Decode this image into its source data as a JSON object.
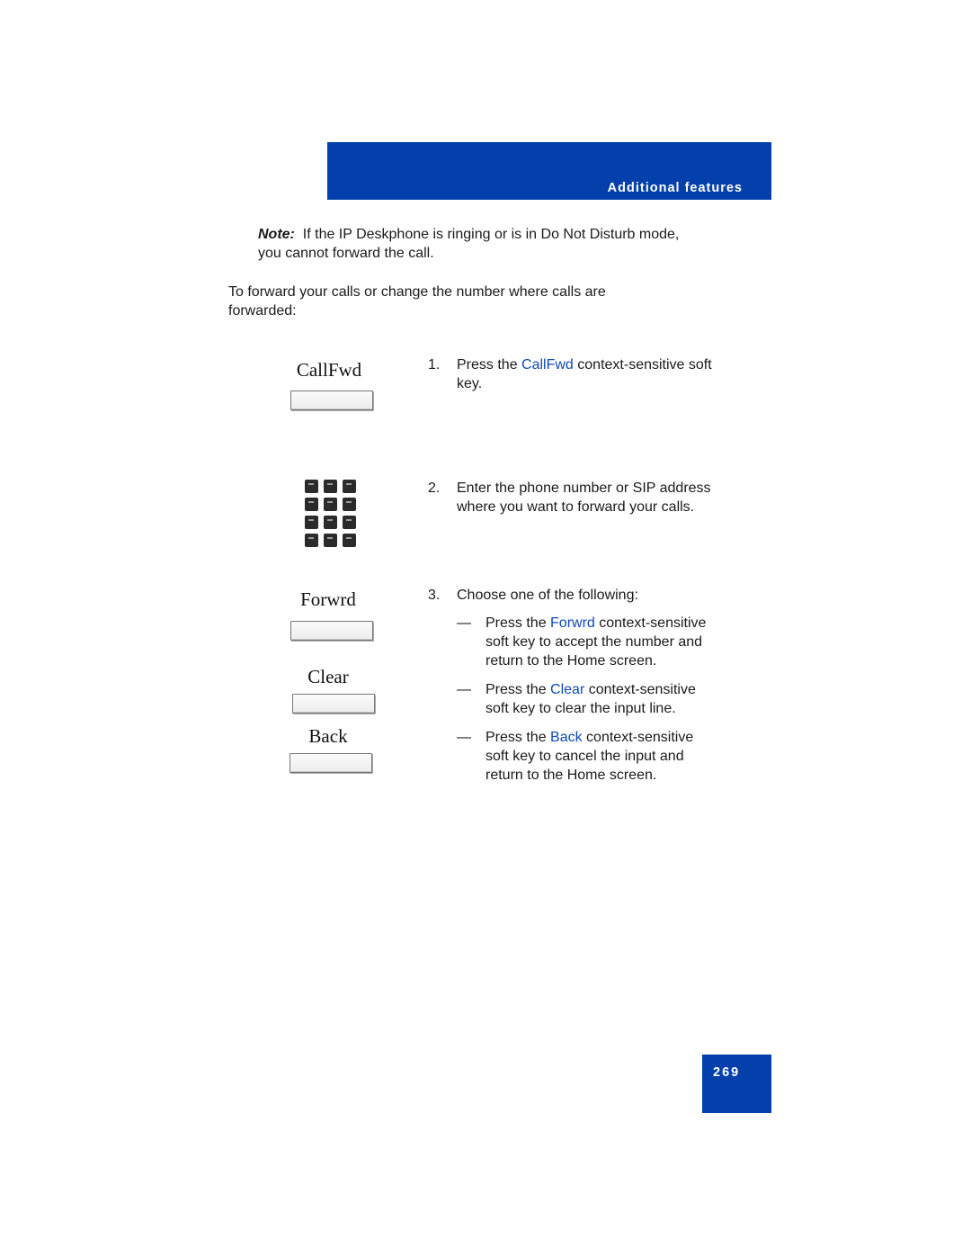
{
  "header": {
    "section_title": "Additional features",
    "color": "#0340AC"
  },
  "note": {
    "label": "Note:",
    "text_line1": "If the IP Deskphone is ringing or is in Do Not Disturb mode,",
    "text_line2": "you cannot forward the call."
  },
  "intro": {
    "line1": "To forward your calls or change the number where calls are",
    "line2": "forwarded:"
  },
  "softkeys": {
    "callfwd": "CallFwd",
    "forwrd": "Forwrd",
    "clear": "Clear",
    "back": "Back"
  },
  "keypad_icon": "dialpad-icon",
  "steps": [
    {
      "num": "1.",
      "pre": "Press the ",
      "keyword": "CallFwd",
      "post": " context-sensitive soft",
      "line2": "key."
    },
    {
      "num": "2.",
      "line1": "Enter the phone number or SIP address",
      "line2": "where you want to forward your calls."
    },
    {
      "num": "3.",
      "line1": "Choose one of the following:",
      "options": [
        {
          "dash": "—",
          "pre": "Press the ",
          "keyword": "Forwrd",
          "post": " context-sensitive",
          "line2": "soft key to accept the number and",
          "line3": "return to the Home screen."
        },
        {
          "dash": "—",
          "pre": "Press the ",
          "keyword": "Clear",
          "post": " context-sensitive",
          "line2": "soft key to clear the input line."
        },
        {
          "dash": "—",
          "pre": "Press the ",
          "keyword": "Back",
          "post": " context-sensitive",
          "line2": "soft key to cancel the input and",
          "line3": "return to the Home screen."
        }
      ]
    }
  ],
  "footer": {
    "page_number": "269"
  }
}
